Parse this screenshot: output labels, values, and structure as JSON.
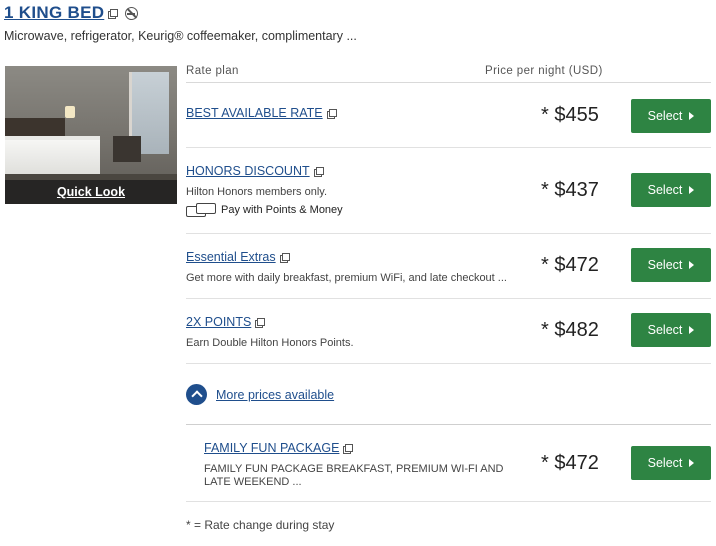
{
  "room": {
    "title": "1 KING BED",
    "amenities": "Microwave, refrigerator, Keurig® coffeemaker, complimentary ...",
    "quick_look": "Quick Look"
  },
  "table": {
    "col_plan": "Rate plan",
    "col_price": "Price per night (USD)"
  },
  "rates": [
    {
      "name": "BEST AVAILABLE RATE",
      "desc": "",
      "price": "* $455",
      "button": "Select"
    },
    {
      "name": "HONORS DISCOUNT",
      "desc": "Hilton Honors members only.",
      "extra": "Pay with Points & Money",
      "price": "* $437",
      "button": "Select"
    },
    {
      "name": "Essential Extras",
      "desc": "Get more with daily breakfast, premium WiFi, and late checkout ...",
      "price": "* $472",
      "button": "Select"
    },
    {
      "name": "2X POINTS",
      "desc": "Earn Double Hilton Honors Points.",
      "price": "* $482",
      "button": "Select"
    }
  ],
  "more_prices": "More prices available",
  "family": {
    "name": "FAMILY FUN PACKAGE",
    "desc_line1": "FAMILY FUN PACKAGE BREAKFAST, PREMIUM WI-FI AND",
    "desc_line2": "LATE WEEKEND ...",
    "price": "* $472",
    "button": "Select"
  },
  "footnote": "* = Rate change during stay",
  "colors": {
    "link": "#1f4e8c",
    "button": "#2e8443"
  },
  "icons": [
    "external-link-icon",
    "no-smoking-icon",
    "points-money-icon",
    "chevron-up-icon",
    "triangle-right-icon"
  ]
}
